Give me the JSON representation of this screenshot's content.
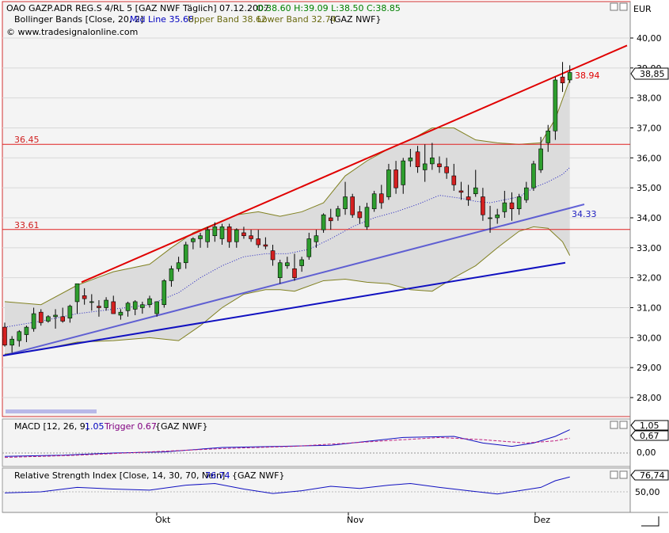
{
  "header": {
    "title": "OAO GAZP.ADR REG.S 4/RL 5 [GAZ NWF  Täglich] 07.12.2007",
    "ohlc": "O:38.60 H:39.09 L:38.50 C:38.85",
    "indicator_name": "Bollinger Bands [Close, 20, 2]",
    "mid": "Mid Line 35.68",
    "upper": "Upper Band 38.62",
    "lower": "Lower Band 32.74",
    "source": "{GAZ NWF}",
    "copyright": "© www.tradesignalonline.com"
  },
  "price_axis": {
    "currency": "EUR",
    "last_value": "38,85"
  },
  "labels": {
    "level_high": "36.45",
    "level_low": "33.61",
    "upper_line": "38.94",
    "lower_line": "34.33"
  },
  "macd_pane": {
    "name": "MACD [12, 26, 9]",
    "macd": "1.05",
    "trigger": "Trigger 0.67",
    "source": "{GAZ NWF}",
    "value1": "1,05",
    "value2": "0,67",
    "zero": "0,00"
  },
  "rsi_pane": {
    "name": "Relative Strength Index [Close, 14, 30, 70, Nein]",
    "value": "76.74",
    "source": "{GAZ NWF}",
    "value_box": "76,74",
    "level": "50,00"
  },
  "chart_data": {
    "type": "candlestick",
    "y_ticks": [
      "40,00",
      "39,00",
      "38,00",
      "37,00",
      "36,00",
      "35,00",
      "34,00",
      "33,00",
      "32,00",
      "31,00",
      "30,00",
      "29,00",
      "28,00"
    ],
    "ylim": [
      27.5,
      40.2
    ],
    "x_labels": [
      "Okt",
      "Nov",
      "Dez"
    ],
    "colors": {
      "up": "#2e9e2e",
      "down": "#d42020",
      "band_line": "#808020",
      "mid": "#2020c0",
      "channel_red": "#e00000",
      "trend_blue": "#4040d0",
      "trend_dark": "#1010c0",
      "hline": "#e02020"
    },
    "candles": [
      [
        30.35,
        30.5,
        29.7,
        29.75
      ],
      [
        29.75,
        30.05,
        29.5,
        29.95
      ],
      [
        29.9,
        30.25,
        29.7,
        30.2
      ],
      [
        30.1,
        30.4,
        29.85,
        30.35
      ],
      [
        30.3,
        31.0,
        30.2,
        30.8
      ],
      [
        30.85,
        30.95,
        30.4,
        30.5
      ],
      [
        30.55,
        30.75,
        30.5,
        30.7
      ],
      [
        30.7,
        30.95,
        30.3,
        30.75
      ],
      [
        30.7,
        31.0,
        30.5,
        30.55
      ],
      [
        30.65,
        31.1,
        30.5,
        31.05
      ],
      [
        31.2,
        31.8,
        30.8,
        31.8
      ],
      [
        31.4,
        31.65,
        31.1,
        31.3
      ],
      [
        31.2,
        31.45,
        30.9,
        31.2
      ],
      [
        31.05,
        31.25,
        30.7,
        31.0
      ],
      [
        31.0,
        31.35,
        30.9,
        31.25
      ],
      [
        31.2,
        31.4,
        30.8,
        30.8
      ],
      [
        30.75,
        30.95,
        30.6,
        30.85
      ],
      [
        30.9,
        31.2,
        30.7,
        31.15
      ],
      [
        30.95,
        31.25,
        30.75,
        31.2
      ],
      [
        31.0,
        31.2,
        30.8,
        31.1
      ],
      [
        31.1,
        31.4,
        31.0,
        31.3
      ],
      [
        30.8,
        31.2,
        30.7,
        31.2
      ],
      [
        31.1,
        31.95,
        31.0,
        31.9
      ],
      [
        31.9,
        32.4,
        31.7,
        32.3
      ],
      [
        32.3,
        32.7,
        32.2,
        32.5
      ],
      [
        32.5,
        33.2,
        32.3,
        33.1
      ],
      [
        33.2,
        33.35,
        32.95,
        33.3
      ],
      [
        33.3,
        33.5,
        33.0,
        33.4
      ],
      [
        33.2,
        33.7,
        33.0,
        33.6
      ],
      [
        33.4,
        33.85,
        33.2,
        33.7
      ],
      [
        33.3,
        33.8,
        33.1,
        33.7
      ],
      [
        33.7,
        33.8,
        33.0,
        33.2
      ],
      [
        33.2,
        33.65,
        33.0,
        33.6
      ],
      [
        33.5,
        33.7,
        33.3,
        33.4
      ],
      [
        33.4,
        33.6,
        33.2,
        33.3
      ],
      [
        33.3,
        33.6,
        33.0,
        33.1
      ],
      [
        33.1,
        33.35,
        32.95,
        33.05
      ],
      [
        32.9,
        33.1,
        32.4,
        32.6
      ],
      [
        32.0,
        32.6,
        31.8,
        32.5
      ],
      [
        32.4,
        32.7,
        32.3,
        32.5
      ],
      [
        32.3,
        32.8,
        31.9,
        32.0
      ],
      [
        32.4,
        32.7,
        32.2,
        32.6
      ],
      [
        32.7,
        33.5,
        32.6,
        33.3
      ],
      [
        33.2,
        33.6,
        33.0,
        33.4
      ],
      [
        33.6,
        34.15,
        33.5,
        34.1
      ],
      [
        34.0,
        34.3,
        33.6,
        33.9
      ],
      [
        34.05,
        34.4,
        33.9,
        34.3
      ],
      [
        34.3,
        35.2,
        34.1,
        34.7
      ],
      [
        34.7,
        34.8,
        34.0,
        34.1
      ],
      [
        34.2,
        34.4,
        33.8,
        34.0
      ],
      [
        33.7,
        34.5,
        33.6,
        34.35
      ],
      [
        34.3,
        34.9,
        34.2,
        34.8
      ],
      [
        34.8,
        35.1,
        34.3,
        34.5
      ],
      [
        34.7,
        35.8,
        34.6,
        35.6
      ],
      [
        35.6,
        35.9,
        34.8,
        35.0
      ],
      [
        35.1,
        36.0,
        34.8,
        35.9
      ],
      [
        35.9,
        36.3,
        35.7,
        36.0
      ],
      [
        36.2,
        36.4,
        35.5,
        35.7
      ],
      [
        35.6,
        36.45,
        35.2,
        35.8
      ],
      [
        35.8,
        36.5,
        35.6,
        36.0
      ],
      [
        35.8,
        36.05,
        35.5,
        35.7
      ],
      [
        35.7,
        36.0,
        35.3,
        35.5
      ],
      [
        35.4,
        35.8,
        34.9,
        35.1
      ],
      [
        34.9,
        35.2,
        34.6,
        34.85
      ],
      [
        34.7,
        35.1,
        34.4,
        34.6
      ],
      [
        34.8,
        35.6,
        34.7,
        35.0
      ],
      [
        34.7,
        35.0,
        33.9,
        34.1
      ],
      [
        34.0,
        34.4,
        33.5,
        34.0
      ],
      [
        34.0,
        34.3,
        33.8,
        34.1
      ],
      [
        34.2,
        34.9,
        34.0,
        34.5
      ],
      [
        34.5,
        34.85,
        33.9,
        34.3
      ],
      [
        34.3,
        34.8,
        34.1,
        34.7
      ],
      [
        34.6,
        35.2,
        34.5,
        35.0
      ],
      [
        35.0,
        35.9,
        34.9,
        35.8
      ],
      [
        35.6,
        36.7,
        35.5,
        36.3
      ],
      [
        36.5,
        37.1,
        36.2,
        36.9
      ],
      [
        36.9,
        38.7,
        36.6,
        38.6
      ],
      [
        38.7,
        39.2,
        38.2,
        38.5
      ],
      [
        38.6,
        39.09,
        38.5,
        38.85
      ]
    ],
    "upper_band": [
      [
        0,
        31.2
      ],
      [
        5,
        31.1
      ],
      [
        10,
        31.75
      ],
      [
        15,
        32.2
      ],
      [
        20,
        32.45
      ],
      [
        23,
        33.0
      ],
      [
        26,
        33.5
      ],
      [
        29,
        33.8
      ],
      [
        32,
        34.1
      ],
      [
        35,
        34.2
      ],
      [
        38,
        34.05
      ],
      [
        41,
        34.2
      ],
      [
        44,
        34.5
      ],
      [
        47,
        35.4
      ],
      [
        50,
        35.9
      ],
      [
        53,
        36.3
      ],
      [
        56,
        36.6
      ],
      [
        59,
        37.0
      ],
      [
        62,
        37.0
      ],
      [
        65,
        36.6
      ],
      [
        68,
        36.5
      ],
      [
        71,
        36.45
      ],
      [
        74,
        36.5
      ],
      [
        76,
        37.3
      ],
      [
        78,
        38.62
      ]
    ],
    "lower_band": [
      [
        0,
        29.45
      ],
      [
        5,
        29.6
      ],
      [
        10,
        29.85
      ],
      [
        15,
        29.9
      ],
      [
        20,
        30.0
      ],
      [
        24,
        29.9
      ],
      [
        27,
        30.4
      ],
      [
        30,
        31.0
      ],
      [
        33,
        31.45
      ],
      [
        36,
        31.6
      ],
      [
        38,
        31.6
      ],
      [
        40,
        31.55
      ],
      [
        44,
        31.9
      ],
      [
        47,
        31.95
      ],
      [
        50,
        31.85
      ],
      [
        53,
        31.8
      ],
      [
        56,
        31.6
      ],
      [
        59,
        31.55
      ],
      [
        62,
        32.0
      ],
      [
        65,
        32.4
      ],
      [
        68,
        33.0
      ],
      [
        71,
        33.55
      ],
      [
        73,
        33.7
      ],
      [
        75,
        33.65
      ],
      [
        77,
        33.2
      ],
      [
        78,
        32.74
      ]
    ],
    "mid_line": [
      [
        0,
        30.35
      ],
      [
        5,
        30.55
      ],
      [
        10,
        30.8
      ],
      [
        15,
        30.95
      ],
      [
        20,
        31.1
      ],
      [
        24,
        31.5
      ],
      [
        27,
        32.0
      ],
      [
        30,
        32.4
      ],
      [
        33,
        32.7
      ],
      [
        36,
        32.8
      ],
      [
        39,
        32.8
      ],
      [
        42,
        32.95
      ],
      [
        45,
        33.3
      ],
      [
        48,
        33.7
      ],
      [
        51,
        34.0
      ],
      [
        54,
        34.2
      ],
      [
        57,
        34.45
      ],
      [
        60,
        34.75
      ],
      [
        63,
        34.65
      ],
      [
        65,
        34.55
      ],
      [
        67,
        34.5
      ],
      [
        69,
        34.6
      ],
      [
        71,
        34.7
      ],
      [
        73,
        35.0
      ],
      [
        75,
        35.2
      ],
      [
        77,
        35.45
      ],
      [
        78,
        35.68
      ]
    ],
    "macd_line": [
      [
        0,
        -0.15
      ],
      [
        8,
        -0.1
      ],
      [
        15,
        0.0
      ],
      [
        22,
        0.05
      ],
      [
        30,
        0.25
      ],
      [
        38,
        0.3
      ],
      [
        45,
        0.35
      ],
      [
        55,
        0.7
      ],
      [
        62,
        0.75
      ],
      [
        66,
        0.45
      ],
      [
        70,
        0.3
      ],
      [
        73,
        0.45
      ],
      [
        76,
        0.75
      ],
      [
        78,
        1.05
      ]
    ],
    "trigger_line": [
      [
        0,
        -0.2
      ],
      [
        10,
        -0.1
      ],
      [
        20,
        0.05
      ],
      [
        30,
        0.2
      ],
      [
        40,
        0.3
      ],
      [
        50,
        0.5
      ],
      [
        60,
        0.7
      ],
      [
        66,
        0.6
      ],
      [
        72,
        0.45
      ],
      [
        76,
        0.55
      ],
      [
        78,
        0.67
      ]
    ],
    "rsi_line": [
      [
        0,
        48
      ],
      [
        5,
        50
      ],
      [
        10,
        58
      ],
      [
        15,
        55
      ],
      [
        20,
        53
      ],
      [
        25,
        62
      ],
      [
        29,
        65
      ],
      [
        33,
        55
      ],
      [
        37,
        47
      ],
      [
        41,
        52
      ],
      [
        45,
        60
      ],
      [
        49,
        56
      ],
      [
        53,
        62
      ],
      [
        56,
        65
      ],
      [
        60,
        58
      ],
      [
        64,
        52
      ],
      [
        68,
        46
      ],
      [
        71,
        52
      ],
      [
        74,
        58
      ],
      [
        76,
        70
      ],
      [
        78,
        76.74
      ]
    ]
  }
}
